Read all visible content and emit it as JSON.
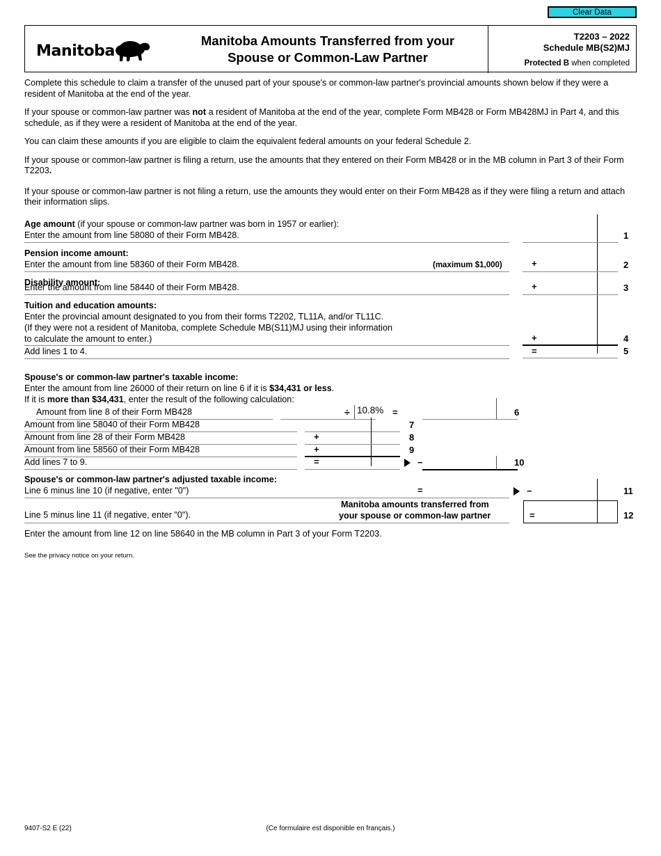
{
  "toolbar": {
    "clear_data_label": "Clear Data",
    "clear_data_color": "#2ad2e2"
  },
  "header": {
    "province_logo_text": "Manitoba",
    "logo_icon": "bison-icon",
    "title_line1": "Manitoba Amounts Transferred from your",
    "title_line2": "Spouse or Common-Law Partner",
    "form_code": "T2203 – 2022",
    "schedule": "Schedule MB(S2)MJ",
    "protected_bold": "Protected B",
    "protected_rest": " when completed"
  },
  "intro": {
    "p1": "Complete this schedule to claim a transfer of the unused part of your spouse's or common-law partner's provincial amounts shown below if they were a resident of Manitoba at the end of the year.",
    "p2_a": "If your spouse or common-law partner was ",
    "p2_b": "not",
    "p2_c": " a resident of Manitoba at the end of the year, complete Form MB428 or Form MB428MJ in Part 4, and this schedule, as if they were a resident of Manitoba at the end of the year.",
    "p3": "You can claim these amounts if you are eligible to claim the equivalent federal amounts on your federal Schedule 2.",
    "p4_a": "If your spouse or common-law partner is filing a return, use the amounts that they entered on their Form MB428 or in the MB column in Part 3 of their Form T2203",
    "p4_b": ".",
    "p5": "If your spouse or common-law partner is not filing a return, use the amounts they would enter on their Form MB428 as if they were filing a return and attach their information slips."
  },
  "section_a": {
    "age_heading": "Age amount",
    "age_heading_rest": " (if your spouse or common-law partner was born in 1957 or earlier):",
    "age_text": "Enter the amount from line 58080 of their Form MB428.",
    "age_line_no": "1",
    "pension_heading": "Pension income amount:",
    "pension_text": "Enter the amount from line 58360 of their Form MB428.",
    "pension_max": "(maximum $1,000)",
    "pension_op": "+",
    "pension_line_no": "2",
    "disability_heading": "Disability amount:",
    "disability_text": "Enter the amount from line 58440 of their Form MB428.",
    "disability_op": "+",
    "disability_line_no": "3",
    "tuition_heading": "Tuition and education amounts:",
    "tuition_text1": "Enter the provincial amount designated to you from their forms T2202, TL11A, and/or TL11C.",
    "tuition_text2": "(If they were not a resident of Manitoba, complete Schedule MB(S11)MJ using their information",
    "tuition_text3": "to calculate the amount to enter.)",
    "tuition_op": "+",
    "tuition_line_no": "4",
    "add_text": "Add lines 1 to 4.",
    "add_op": "=",
    "add_line_no": "5"
  },
  "section_b": {
    "income_heading": "Spouse's or common-law partner's taxable income:",
    "income_text1_a": "Enter the amount from line 26000 of their return on line 6 if it is ",
    "income_text1_b": "$34,431 or less",
    "income_text1_c": ".",
    "income_text2_a": "If it is ",
    "income_text2_b": "more than $34,431",
    "income_text2_c": ", enter the result of the following calculation:",
    "row6_text": "Amount from line 8 of their Form MB428",
    "row6_divide": "÷",
    "row6_rate": "10.8%",
    "row6_equals": "=",
    "row6_line_no": "6",
    "row7_text": "Amount from line 58040 of their Form MB428",
    "row7_line_no": "7",
    "row8_text": "Amount from line 28 of their Form MB428",
    "row8_op": "+",
    "row8_line_no": "8",
    "row9_text": "Amount from line 58560 of their Form MB428",
    "row9_op": "+",
    "row9_line_no": "9",
    "row10_text": "Add lines 7 to 9.",
    "row10_op": "=",
    "row10_minus": "−",
    "row10_line_no": "10",
    "adjusted_heading": "Spouse's or common-law partner's adjusted taxable income:",
    "row11_text": "Line 6 minus line 10 (if negative, enter \"0\")",
    "row11_op": "=",
    "row11_minus": "−",
    "row11_line_no": "11",
    "row12_text": "Line 5 minus line 11 (if negative, enter \"0\").",
    "row12_label1": "Manitoba amounts transferred from",
    "row12_label2": "your spouse or common-law partner",
    "row12_op": "=",
    "row12_line_no": "12"
  },
  "closing": {
    "instruction": "Enter the amount from line 12 on line 58640 in the MB column in Part 3 of your Form T2203.",
    "privacy": "See the privacy notice on your return."
  },
  "footer": {
    "form_id": "9407-S2 E (22)",
    "french_note": "(Ce formulaire est disponible en français.)"
  },
  "fields": {
    "age_amount": "",
    "pension_amount": "",
    "disability_amount": "",
    "tuition_amount": "",
    "total_line5": "",
    "line8_amount": "",
    "line8_minus_base": "",
    "line6_result": "",
    "line58040": "",
    "line28": "",
    "line58560": "",
    "line10_total": "",
    "line10_result": "",
    "line11_result": "",
    "line11_carry": "",
    "line12_result": ""
  }
}
